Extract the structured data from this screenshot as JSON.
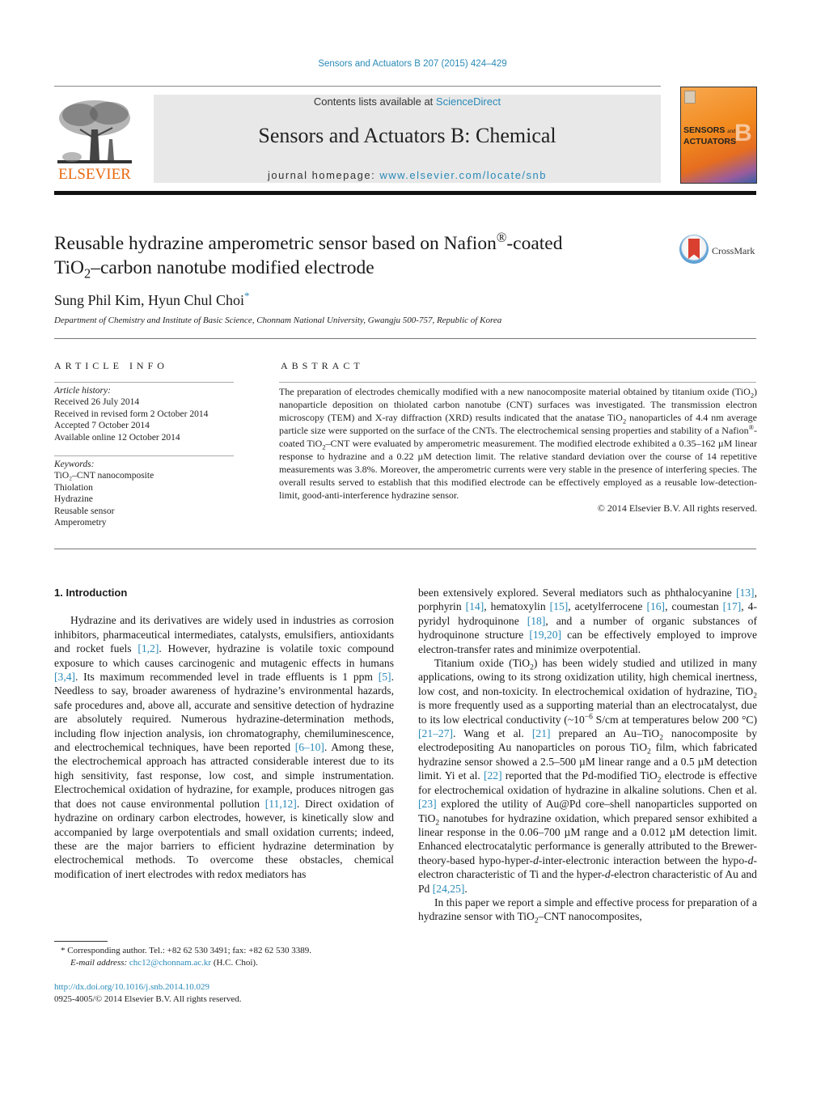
{
  "header": {
    "citation": "Sensors and Actuators B 207 (2015) 424–429",
    "contents_prefix": "Contents lists available at ",
    "contents_link": "ScienceDirect",
    "journal_title": "Sensors and Actuators B: Chemical",
    "homepage_prefix": "journal homepage: ",
    "homepage_link": "www.elsevier.com/locate/snb",
    "publisher_logo_text": "ELSEVIER",
    "cover": {
      "line1": "SENSORS",
      "line1_small": "and",
      "line2": "ACTUATORS",
      "letter": "B"
    },
    "colors": {
      "link": "#2a8ab8",
      "elsevier_orange": "#e86a10"
    }
  },
  "article": {
    "title_part1": "Reusable hydrazine amperometric sensor based on Nafion",
    "title_reg": "®",
    "title_part2": "-coated",
    "title_line2_pre": "TiO",
    "title_line2_sub": "2",
    "title_line2_post": "–carbon nanotube modified electrode",
    "crossmark_label": "CrossMark",
    "authors": "Sung Phil Kim, Hyun Chul Choi",
    "author_mark": "*",
    "affiliation": "Department of Chemistry and Institute of Basic Science, Chonnam National University, Gwangju 500-757, Republic of Korea"
  },
  "article_info": {
    "heading": "ARTICLE INFO",
    "history_label": "Article history:",
    "history": [
      "Received 26 July 2014",
      "Received in revised form 2 October 2014",
      "Accepted 7 October 2014",
      "Available online 12 October 2014"
    ],
    "keywords_label": "Keywords:",
    "keywords": [
      "TiO₂–CNT nanocomposite",
      "Thiolation",
      "Hydrazine",
      "Reusable sensor",
      "Amperometry"
    ]
  },
  "abstract": {
    "heading": "ABSTRACT",
    "s1": "The preparation of electrodes chemically modified with a new nanocomposite material obtained by titanium oxide (TiO",
    "s2": ") nanoparticle deposition on thiolated carbon nanotube (CNT) surfaces was investigated. The transmission electron microscopy (TEM) and X-ray diffraction (XRD) results indicated that the anatase TiO",
    "s3": " nanoparticles of 4.4 nm average particle size were supported on the surface of the CNTs. The electrochemical sensing properties and stability of a Nafion",
    "s4": "-coated TiO",
    "s5": "–CNT were evaluated by amperometric measurement. The modified electrode exhibited a 0.35–162 µM linear response to hydrazine and a 0.22 µM detection limit. The relative standard deviation over the course of 14 repetitive measurements was 3.8%. Moreover, the amperometric currents were very stable in the presence of interfering species. The overall results served to establish that this modified electrode can be effectively employed as a reusable low-detection-limit, good-anti-interference hydrazine sensor.",
    "sub2": "2",
    "reg": "®",
    "copyright": "© 2014 Elsevier B.V. All rights reserved."
  },
  "intro": {
    "heading": "1.  Introduction",
    "p1": [
      {
        "t": "Hydrazine and its derivatives are widely used in industries as corrosion inhibitors, pharmaceutical intermediates, catalysts, emulsifiers, antioxidants and rocket fuels "
      },
      {
        "ref": "[1,2]"
      },
      {
        "t": ". However, hydrazine is volatile toxic compound exposure to which causes carcinogenic and mutagenic effects in humans "
      },
      {
        "ref": "[3,4]"
      },
      {
        "t": ". Its maximum recommended level in trade effluents is 1 ppm "
      },
      {
        "ref": "[5]"
      },
      {
        "t": ". Needless to say, broader awareness of hydrazine’s environmental hazards, safe procedures and, above all, accurate and sensitive detection of hydrazine are absolutely required. Numerous hydrazine-determination methods, including flow injection analysis, ion chromatography, chemiluminescence, and electrochemical techniques, have been reported "
      },
      {
        "ref": "[6–10]"
      },
      {
        "t": ". Among these, the electrochemical approach has attracted considerable interest due to its high sensitivity, fast response, low cost, and simple instrumentation. Electrochemical oxidation of hydrazine, for example, produces nitrogen gas that does not cause environmental pollution "
      },
      {
        "ref": "[11,12]"
      },
      {
        "t": ". Direct oxidation of hydrazine on ordinary carbon electrodes, however, is kinetically slow and accompanied by large overpotentials and small oxidation currents; indeed, these are the major barriers to efficient hydrazine determination by electrochemical methods. To overcome these obstacles, chemical modification of inert electrodes with redox mediators has been extensively explored. Several mediators such as phthalocyanine "
      }
    ],
    "right_p1": [
      {
        "t": "been extensively explored. Several mediators such as phthalocyanine "
      },
      {
        "ref": "[13]"
      },
      {
        "t": ", porphyrin "
      },
      {
        "ref": "[14]"
      },
      {
        "t": ", hematoxylin "
      },
      {
        "ref": "[15]"
      },
      {
        "t": ", acetylferrocene "
      },
      {
        "ref": "[16]"
      },
      {
        "t": ", coumestan "
      },
      {
        "ref": "[17]"
      },
      {
        "t": ", 4-pyridyl hydroquinone "
      },
      {
        "ref": "[18]"
      },
      {
        "t": ", and a number of organic substances of hydroquinone structure "
      },
      {
        "ref": "[19,20]"
      },
      {
        "t": " can be effectively employed to improve electron-transfer rates and minimize overpotential."
      }
    ],
    "right_p2": [
      {
        "t": "Titanium oxide (TiO"
      },
      {
        "sub": "2"
      },
      {
        "t": ") has been widely studied and utilized in many applications, owing to its strong oxidization utility, high chemical inertness, low cost, and non-toxicity. In electrochemical oxidation of hydrazine, TiO"
      },
      {
        "sub": "2"
      },
      {
        "t": " is more frequently used as a supporting material than an electrocatalyst, due to its low electrical conductivity (~10"
      },
      {
        "sup": "−6"
      },
      {
        "t": " S/cm at temperatures below 200 °C) "
      },
      {
        "ref": "[21–27]"
      },
      {
        "t": ". Wang et al. "
      },
      {
        "ref": "[21]"
      },
      {
        "t": " prepared an Au–TiO"
      },
      {
        "sub": "2"
      },
      {
        "t": " nanocomposite by electrodepositing Au nanoparticles on porous TiO"
      },
      {
        "sub": "2"
      },
      {
        "t": " film, which fabricated hydrazine sensor showed a 2.5–500 µM linear range and a 0.5 µM detection limit. Yi et al. "
      },
      {
        "ref": "[22]"
      },
      {
        "t": " reported that the Pd-modified TiO"
      },
      {
        "sub": "2"
      },
      {
        "t": " electrode is effective for electrochemical oxidation of hydrazine in alkaline solutions. Chen et al. "
      },
      {
        "ref": "[23]"
      },
      {
        "t": " explored the utility of Au@Pd core–shell nanoparticles supported on TiO"
      },
      {
        "sub": "2"
      },
      {
        "t": " nanotubes for hydrazine oxidation, which prepared sensor exhibited a linear response in the 0.06–700 µM range and a 0.012 µM detection limit. Enhanced electrocatalytic performance is generally attributed to the Brewer-theory-based hypo-hyper-"
      },
      {
        "i": "d"
      },
      {
        "t": "-inter-electronic interaction between the hypo-"
      },
      {
        "i": "d"
      },
      {
        "t": "-electron characteristic of Ti and the hyper-"
      },
      {
        "i": "d"
      },
      {
        "t": "-electron characteristic of Au and Pd "
      },
      {
        "ref": "[24,25]"
      },
      {
        "t": "."
      }
    ],
    "right_p3": [
      {
        "t": "In this paper we report a simple and effective process for preparation of a hydrazine sensor with TiO"
      },
      {
        "sub": "2"
      },
      {
        "t": "–CNT nanocomposites,"
      }
    ]
  },
  "footnote": {
    "star": "*",
    "text": " Corresponding author. Tel.: +82 62 530 3491; fax: +82 62 530 3389.",
    "email_label": "E-mail address: ",
    "email": "chc12@chonnam.ac.kr",
    "email_suffix": " (H.C. Choi)."
  },
  "doi": {
    "link": "http://dx.doi.org/10.1016/j.snb.2014.10.029",
    "issn": "0925-4005/© 2014 Elsevier B.V. All rights reserved."
  }
}
